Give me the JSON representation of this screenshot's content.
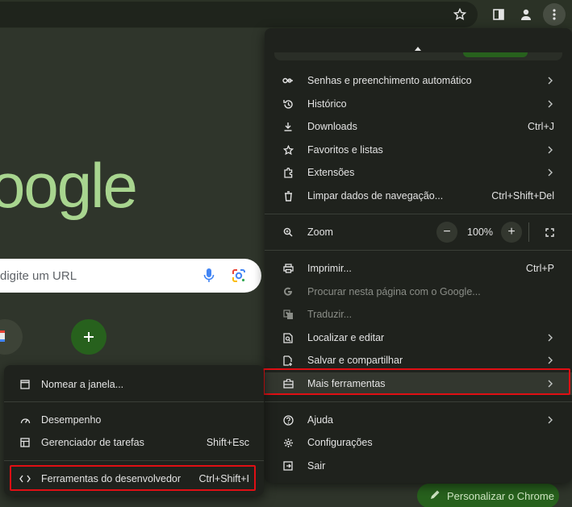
{
  "search": {
    "placeholder_text": "digite um URL"
  },
  "logo": {
    "text": "oogle"
  },
  "customize": {
    "label": "Personalizar o Chrome"
  },
  "main_menu": {
    "items": [
      {
        "label": "Senhas e preenchimento automático",
        "icon": "key-icon",
        "has_submenu": true
      },
      {
        "label": "Histórico",
        "icon": "history-icon",
        "has_submenu": true
      },
      {
        "label": "Downloads",
        "icon": "download-icon",
        "shortcut": "Ctrl+J"
      },
      {
        "label": "Favoritos e listas",
        "icon": "star-icon",
        "has_submenu": true
      },
      {
        "label": "Extensões",
        "icon": "puzzle-icon",
        "has_submenu": true
      },
      {
        "label": "Limpar dados de navegação...",
        "icon": "trash-icon",
        "shortcut": "Ctrl+Shift+Del"
      }
    ],
    "zoom": {
      "label": "Zoom",
      "value": "100%",
      "minus": "−",
      "plus": "+"
    },
    "items2": [
      {
        "label": "Imprimir...",
        "icon": "print-icon",
        "shortcut": "Ctrl+P"
      },
      {
        "label": "Procurar nesta página com o Google...",
        "icon": "google-icon",
        "disabled": true
      },
      {
        "label": "Traduzir...",
        "icon": "translate-icon",
        "disabled": true
      },
      {
        "label": "Localizar e editar",
        "icon": "find-icon",
        "has_submenu": true
      },
      {
        "label": "Salvar e compartilhar",
        "icon": "save-share-icon",
        "has_submenu": true
      },
      {
        "label": "Mais ferramentas",
        "icon": "toolbox-icon",
        "has_submenu": true
      }
    ],
    "items3": [
      {
        "label": "Ajuda",
        "icon": "help-icon",
        "has_submenu": true
      },
      {
        "label": "Configurações",
        "icon": "settings-icon"
      },
      {
        "label": "Sair",
        "icon": "exit-icon"
      }
    ]
  },
  "sub_menu": {
    "items": [
      {
        "label": "Nomear a janela...",
        "icon": "window-icon"
      },
      {
        "label": "Desempenho",
        "icon": "performance-icon"
      },
      {
        "label": "Gerenciador de tarefas",
        "icon": "task-manager-icon",
        "shortcut": "Shift+Esc"
      },
      {
        "label": "Ferramentas do desenvolvedor",
        "icon": "code-icon",
        "shortcut": "Ctrl+Shift+I"
      }
    ]
  },
  "colors": {
    "highlight": "#e00f14",
    "accent_green": "#27611d",
    "menu_bg": "#1f221d",
    "logo_green": "#a8d58f"
  }
}
